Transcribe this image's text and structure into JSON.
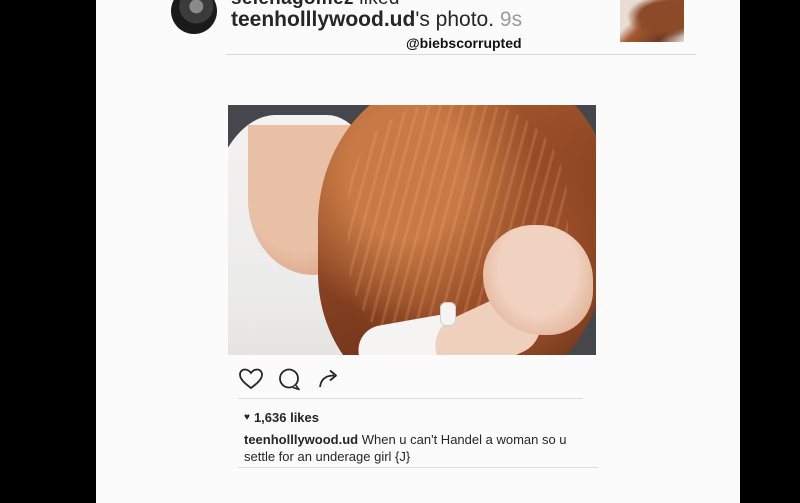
{
  "notification": {
    "previous_user": "selenagomez",
    "previous_action": " liked",
    "username": "teenholllywood.ud",
    "action_text": "'s photo. ",
    "time": "9s",
    "watermark": "@biebscorrupted"
  },
  "post": {
    "likes": "1,636 likes",
    "caption_user": "teenholllywood.ud",
    "caption_text": " When u can't Handel a woman so u settle for an underage girl {J}"
  },
  "icons": {
    "like": "heart-outline-icon",
    "comment": "comment-bubble-icon",
    "share": "share-arrow-icon",
    "likes_heart": "heart-filled-icon"
  },
  "colors": {
    "text": "#262626",
    "muted": "#9a9a9a",
    "background": "#fbfbfb",
    "frame": "#000000"
  }
}
